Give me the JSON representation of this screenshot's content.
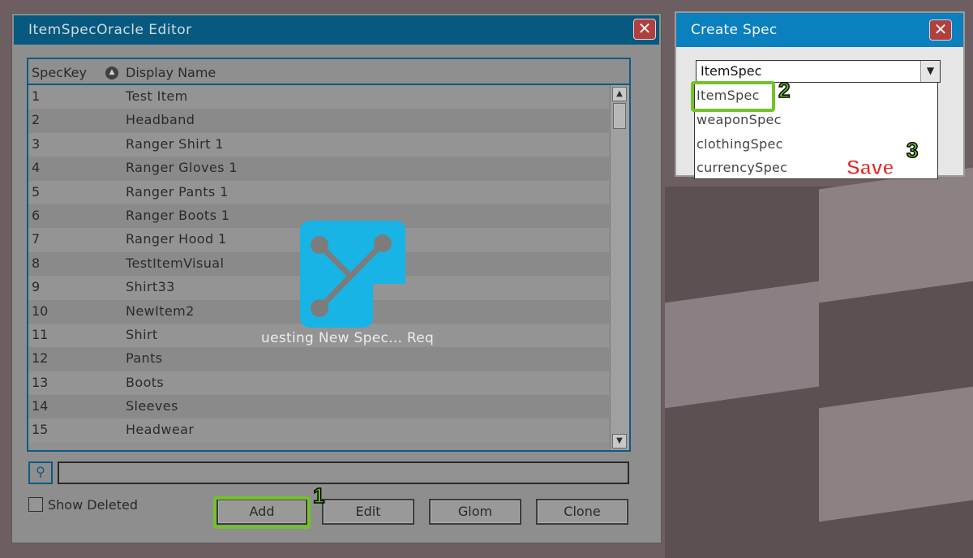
{
  "editor": {
    "title": "ItemSpecOracle Editor",
    "close_icon": "close-icon",
    "columns": {
      "key": "SpecKey",
      "name": "Display Name"
    },
    "rows": [
      {
        "key": "1",
        "name": "Test Item"
      },
      {
        "key": "2",
        "name": "Headband"
      },
      {
        "key": "3",
        "name": "Ranger Shirt 1"
      },
      {
        "key": "4",
        "name": "Ranger Gloves 1"
      },
      {
        "key": "5",
        "name": "Ranger Pants 1"
      },
      {
        "key": "6",
        "name": "Ranger Boots 1"
      },
      {
        "key": "7",
        "name": "Ranger Hood 1"
      },
      {
        "key": "8",
        "name": "TestItemVisual"
      },
      {
        "key": "9",
        "name": "Shirt33"
      },
      {
        "key": "10",
        "name": "NewItem2"
      },
      {
        "key": "11",
        "name": "Shirt"
      },
      {
        "key": "12",
        "name": "Pants"
      },
      {
        "key": "13",
        "name": "Boots"
      },
      {
        "key": "14",
        "name": "Sleeves"
      },
      {
        "key": "15",
        "name": "Headwear"
      }
    ],
    "search_value": "",
    "show_deleted_label": "Show Deleted",
    "show_deleted_checked": false,
    "buttons": {
      "add": "Add",
      "edit": "Edit",
      "glom": "Glom",
      "clone": "Clone"
    },
    "loading_text": "uesting New Spec...   Req",
    "loading_color": "#18b4e6"
  },
  "create_spec": {
    "title": "Create Spec",
    "selected": "ItemSpec",
    "options": [
      "ItemSpec",
      "weaponSpec",
      "clothingSpec",
      "currencySpec"
    ]
  },
  "annotations": {
    "step1": "1",
    "step2": "2",
    "step3": "3",
    "save": "Save",
    "highlight_color": "#73c22a"
  }
}
